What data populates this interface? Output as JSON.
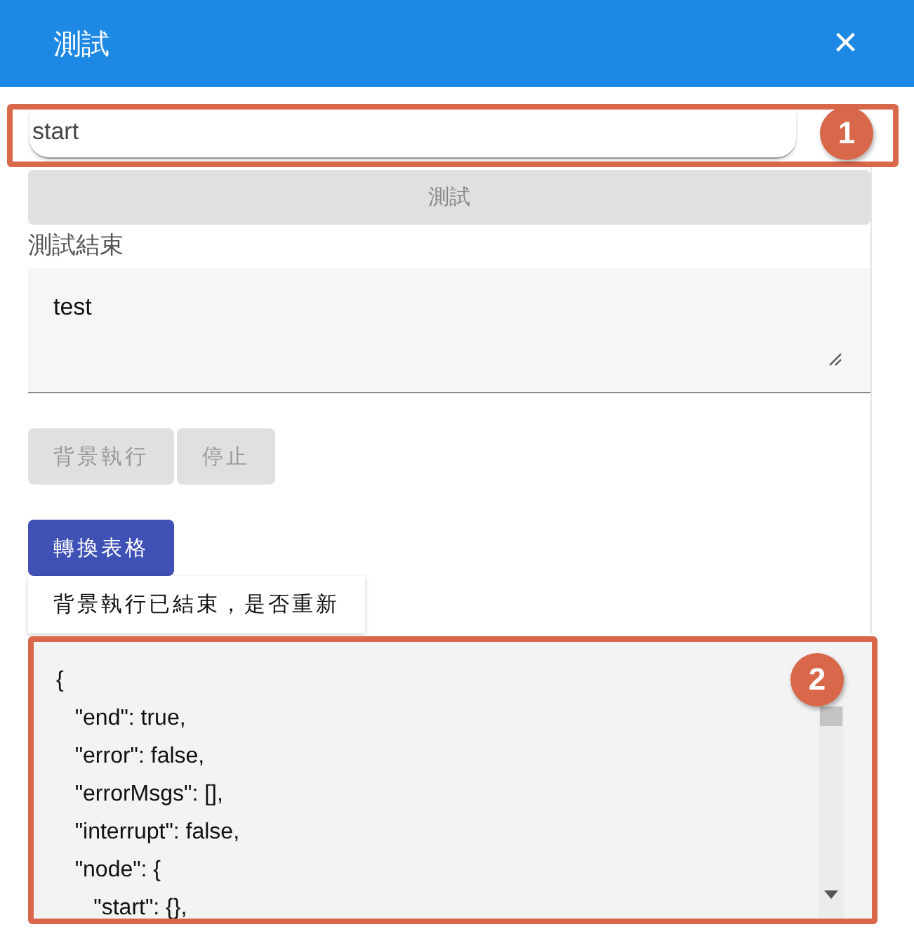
{
  "dialog": {
    "title": "測試",
    "close": "×"
  },
  "input": {
    "value": "start",
    "callout": "1"
  },
  "test_button": {
    "label": "測試",
    "disabled": true
  },
  "status_label": "測試結束",
  "result_field": {
    "value": "test"
  },
  "actions": [
    {
      "label": "背景執行",
      "disabled": true
    },
    {
      "label": "停止",
      "disabled": true
    }
  ],
  "convert_button": {
    "label": "轉換表格",
    "disabled": false
  },
  "notice": "背景執行已結束，是否重新",
  "output": {
    "callout": "2",
    "lines": [
      "{",
      "   \"end\": true,",
      "   \"error\": false,",
      "   \"errorMsgs\": [],",
      "   \"interrupt\": false,",
      "   \"node\": {",
      "      \"start\": {},"
    ]
  }
}
